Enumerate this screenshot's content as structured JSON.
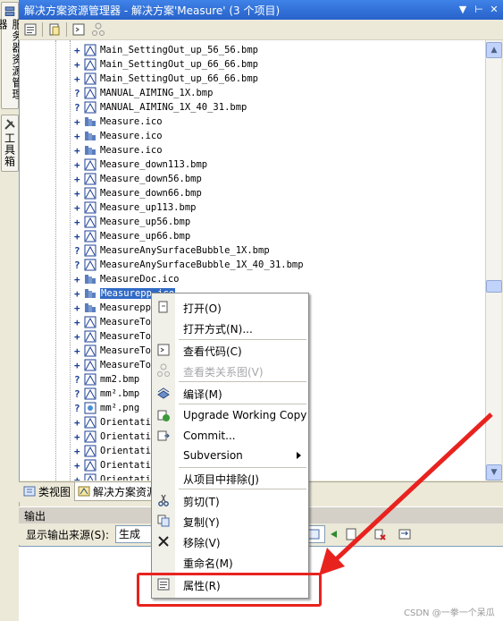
{
  "window": {
    "title": "解决方案资源管理器 - 解决方案'Measure' (3 个项目)"
  },
  "side_tabs": {
    "server_explorer": "服务器资源管理器",
    "toolbox": "工具箱"
  },
  "tree_items": [
    {
      "label": "Main_SettingOut_up_56_56.bmp",
      "marker": "+",
      "icon": "bmp"
    },
    {
      "label": "Main_SettingOut_up_66_66.bmp",
      "marker": "+",
      "icon": "bmp"
    },
    {
      "label": "Main_SettingOut_up_66_66.bmp",
      "marker": "+",
      "icon": "bmp"
    },
    {
      "label": "MANUAL_AIMING_1X.bmp",
      "marker": "?",
      "icon": "bmp"
    },
    {
      "label": "MANUAL_AIMING_1X_40_31.bmp",
      "marker": "?",
      "icon": "bmp"
    },
    {
      "label": "Measure.ico",
      "marker": "+",
      "icon": "ico"
    },
    {
      "label": "Measure.ico",
      "marker": "+",
      "icon": "ico"
    },
    {
      "label": "Measure.ico",
      "marker": "+",
      "icon": "ico"
    },
    {
      "label": "Measure_down113.bmp",
      "marker": "+",
      "icon": "bmp"
    },
    {
      "label": "Measure_down56.bmp",
      "marker": "+",
      "icon": "bmp"
    },
    {
      "label": "Measure_down66.bmp",
      "marker": "+",
      "icon": "bmp"
    },
    {
      "label": "Measure_up113.bmp",
      "marker": "+",
      "icon": "bmp"
    },
    {
      "label": "Measure_up56.bmp",
      "marker": "+",
      "icon": "bmp"
    },
    {
      "label": "Measure_up66.bmp",
      "marker": "+",
      "icon": "bmp"
    },
    {
      "label": "MeasureAnySurfaceBubble_1X.bmp",
      "marker": "?",
      "icon": "bmp"
    },
    {
      "label": "MeasureAnySurfaceBubble_1X_40_31.bmp",
      "marker": "?",
      "icon": "bmp"
    },
    {
      "label": "MeasureDoc.ico",
      "marker": "+",
      "icon": "ico"
    },
    {
      "label": "Measurepp.ico",
      "marker": "+",
      "icon": "ico",
      "selected": true
    },
    {
      "label": "Measurepp",
      "marker": "+",
      "icon": "ico"
    },
    {
      "label": "MeasureTo",
      "marker": "+",
      "icon": "bmp"
    },
    {
      "label": "MeasureTo",
      "marker": "+",
      "icon": "bmp"
    },
    {
      "label": "MeasureTo",
      "marker": "+",
      "icon": "bmp"
    },
    {
      "label": "MeasureTo",
      "marker": "+",
      "icon": "bmp"
    },
    {
      "label": "mm2.bmp",
      "marker": "?",
      "icon": "bmp"
    },
    {
      "label": "mm².bmp",
      "marker": "?",
      "icon": "bmp"
    },
    {
      "label": "mm².png",
      "marker": "?",
      "icon": "png"
    },
    {
      "label": "Orientati",
      "marker": "+",
      "icon": "bmp"
    },
    {
      "label": "Orientati",
      "marker": "+",
      "icon": "bmp"
    },
    {
      "label": "Orientati",
      "marker": "+",
      "icon": "bmp"
    },
    {
      "label": "Orientati",
      "marker": "+",
      "icon": "bmp"
    },
    {
      "label": "Orientati",
      "marker": "+",
      "icon": "bmp"
    }
  ],
  "bottom_tabs": {
    "class_view": "类视图",
    "solution_explorer": "解决方案资源"
  },
  "output": {
    "header": "输出",
    "source_label": "显示输出来源(S):",
    "source_value": "生成"
  },
  "context_menu": {
    "open": "打开(O)",
    "open_with": "打开方式(N)...",
    "view_code": "查看代码(C)",
    "view_class_diagram": "查看类关系图(V)",
    "compile": "编译(M)",
    "upgrade_working_copy": "Upgrade Working Copy",
    "commit": "Commit...",
    "subversion": "Subversion",
    "exclude_from_project": "从项目中排除(J)",
    "cut": "剪切(T)",
    "copy": "复制(Y)",
    "remove": "移除(V)",
    "rename": "重命名(M)",
    "properties": "属性(R)"
  },
  "watermark": "CSDN @一拳一个呆瓜",
  "colors": {
    "selection": "#316ac5",
    "title_bar": "#2762c9",
    "highlight_box": "#e8231f"
  }
}
